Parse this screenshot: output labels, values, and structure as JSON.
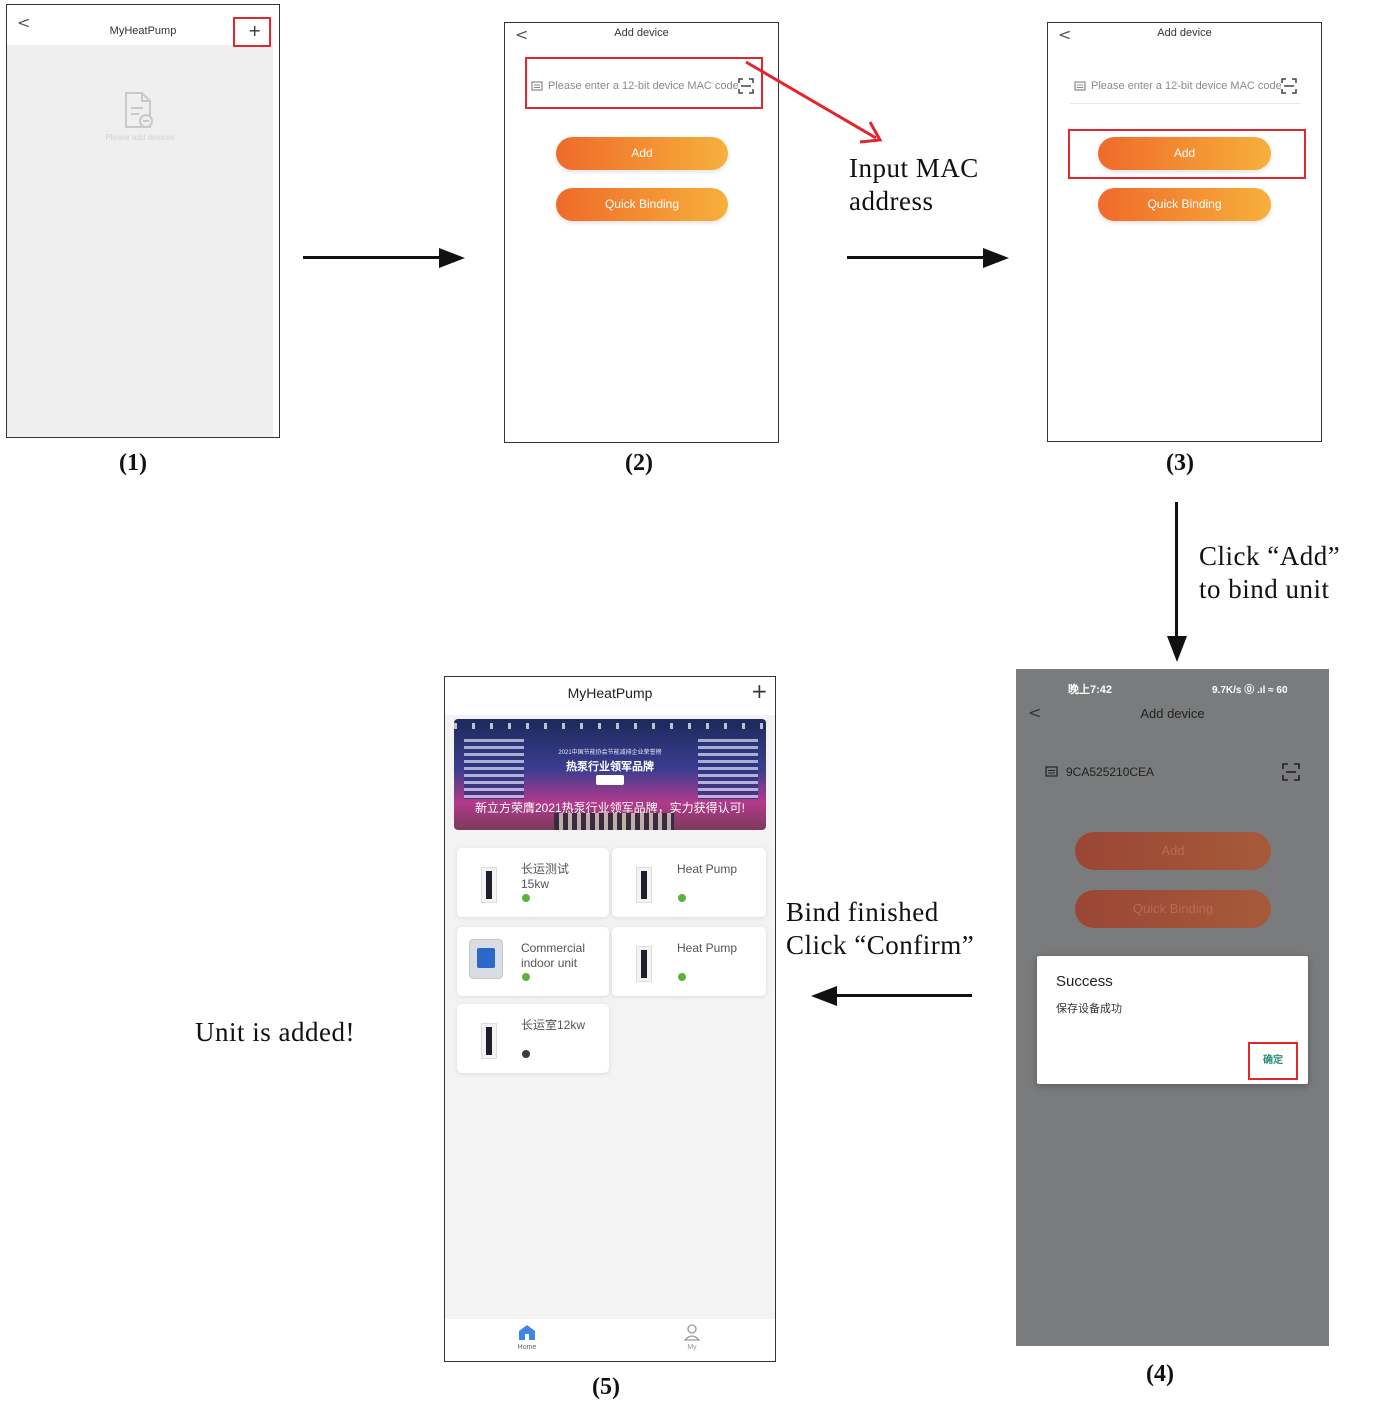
{
  "screen1": {
    "title": "MyHeatPump",
    "back_glyph": "<",
    "plus_glyph": "+",
    "empty_icon": "document-icon",
    "empty_text": "Please add devices",
    "caption": "(1)"
  },
  "screen2": {
    "title": "Add device",
    "back_glyph": "<",
    "input_placeholder": "Please enter a 12-bit device MAC code",
    "add_label": "Add",
    "quick_binding_label": "Quick Binding",
    "caption": "(2)"
  },
  "screen3": {
    "title": "Add device",
    "back_glyph": "<",
    "input_placeholder": "Please enter a 12-bit device MAC code",
    "add_label": "Add",
    "quick_binding_label": "Quick Binding",
    "caption": "(3)"
  },
  "screen4": {
    "status_time": "晚上7:42",
    "status_right": "9.7K/s ⓪ .ıl ≈ 60",
    "title": "Add device",
    "back_glyph": "<",
    "mac_value": "9CA525210CEA",
    "add_label": "Add",
    "quick_binding_label": "Quick Binding",
    "dialog_title": "Success",
    "dialog_message": "保存设备成功",
    "dialog_confirm": "确定",
    "caption": "(4)"
  },
  "screen5": {
    "title": "MyHeatPump",
    "plus_glyph": "+",
    "banner_line1": "2021中国节能协会节能减排企业荣誉榜",
    "banner_line2": "热泵行业领军品牌",
    "banner_line3": "新立方荣膺2021热泵行业领军品牌，实力获得认可!",
    "devices": [
      {
        "name": "长运测试\n15kw",
        "status_color": "#5cb33b"
      },
      {
        "name": "Heat Pump",
        "status_color": "#5cb33b"
      },
      {
        "name": "Commercial\nindoor unit",
        "status_color": "#5cb33b"
      },
      {
        "name": "Heat Pump",
        "status_color": "#5cb33b"
      },
      {
        "name": "长运室12kw",
        "status_color": "#3a3a3a"
      }
    ],
    "nav_home": "Home",
    "nav_my": "My",
    "caption": "(5)"
  },
  "annotations": {
    "input_mac_1": "Input MAC",
    "input_mac_2": "address",
    "click_add_1": "Click “Add”",
    "click_add_2": "to bind unit",
    "bind_finished_1": "Bind finished",
    "bind_finished_2": "Click “Confirm”",
    "unit_added": "Unit is added!"
  },
  "colors": {
    "highlight": "#e1262d",
    "button_start": "#ef6a2a",
    "button_end": "#f7b03b",
    "online": "#5cb33b",
    "offline": "#3a3a3a"
  }
}
